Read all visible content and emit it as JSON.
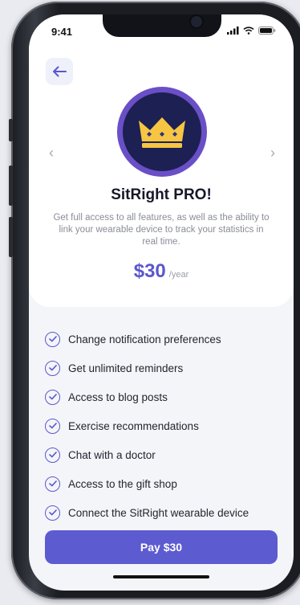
{
  "status_bar": {
    "time": "9:41"
  },
  "product": {
    "title": "SitRight PRO!",
    "description": "Get full access to all features, as well as the ability to link your wearable device to track your statistics in real time.",
    "price": "$30",
    "period": "/year",
    "logo_icon": "crown-icon"
  },
  "features": [
    {
      "label": "Change notification preferences"
    },
    {
      "label": "Get unlimited reminders"
    },
    {
      "label": "Access to blog posts"
    },
    {
      "label": "Exercise recommendations"
    },
    {
      "label": "Chat with a doctor"
    },
    {
      "label": "Access to the gift shop"
    },
    {
      "label": "Connect the SitRight wearable device"
    }
  ],
  "cta": {
    "label": "Pay $30"
  },
  "colors": {
    "accent": "#5d5bd0",
    "logo_ring": "#6a4fc7",
    "logo_bg": "#1c2052",
    "crown": "#f6c543"
  }
}
